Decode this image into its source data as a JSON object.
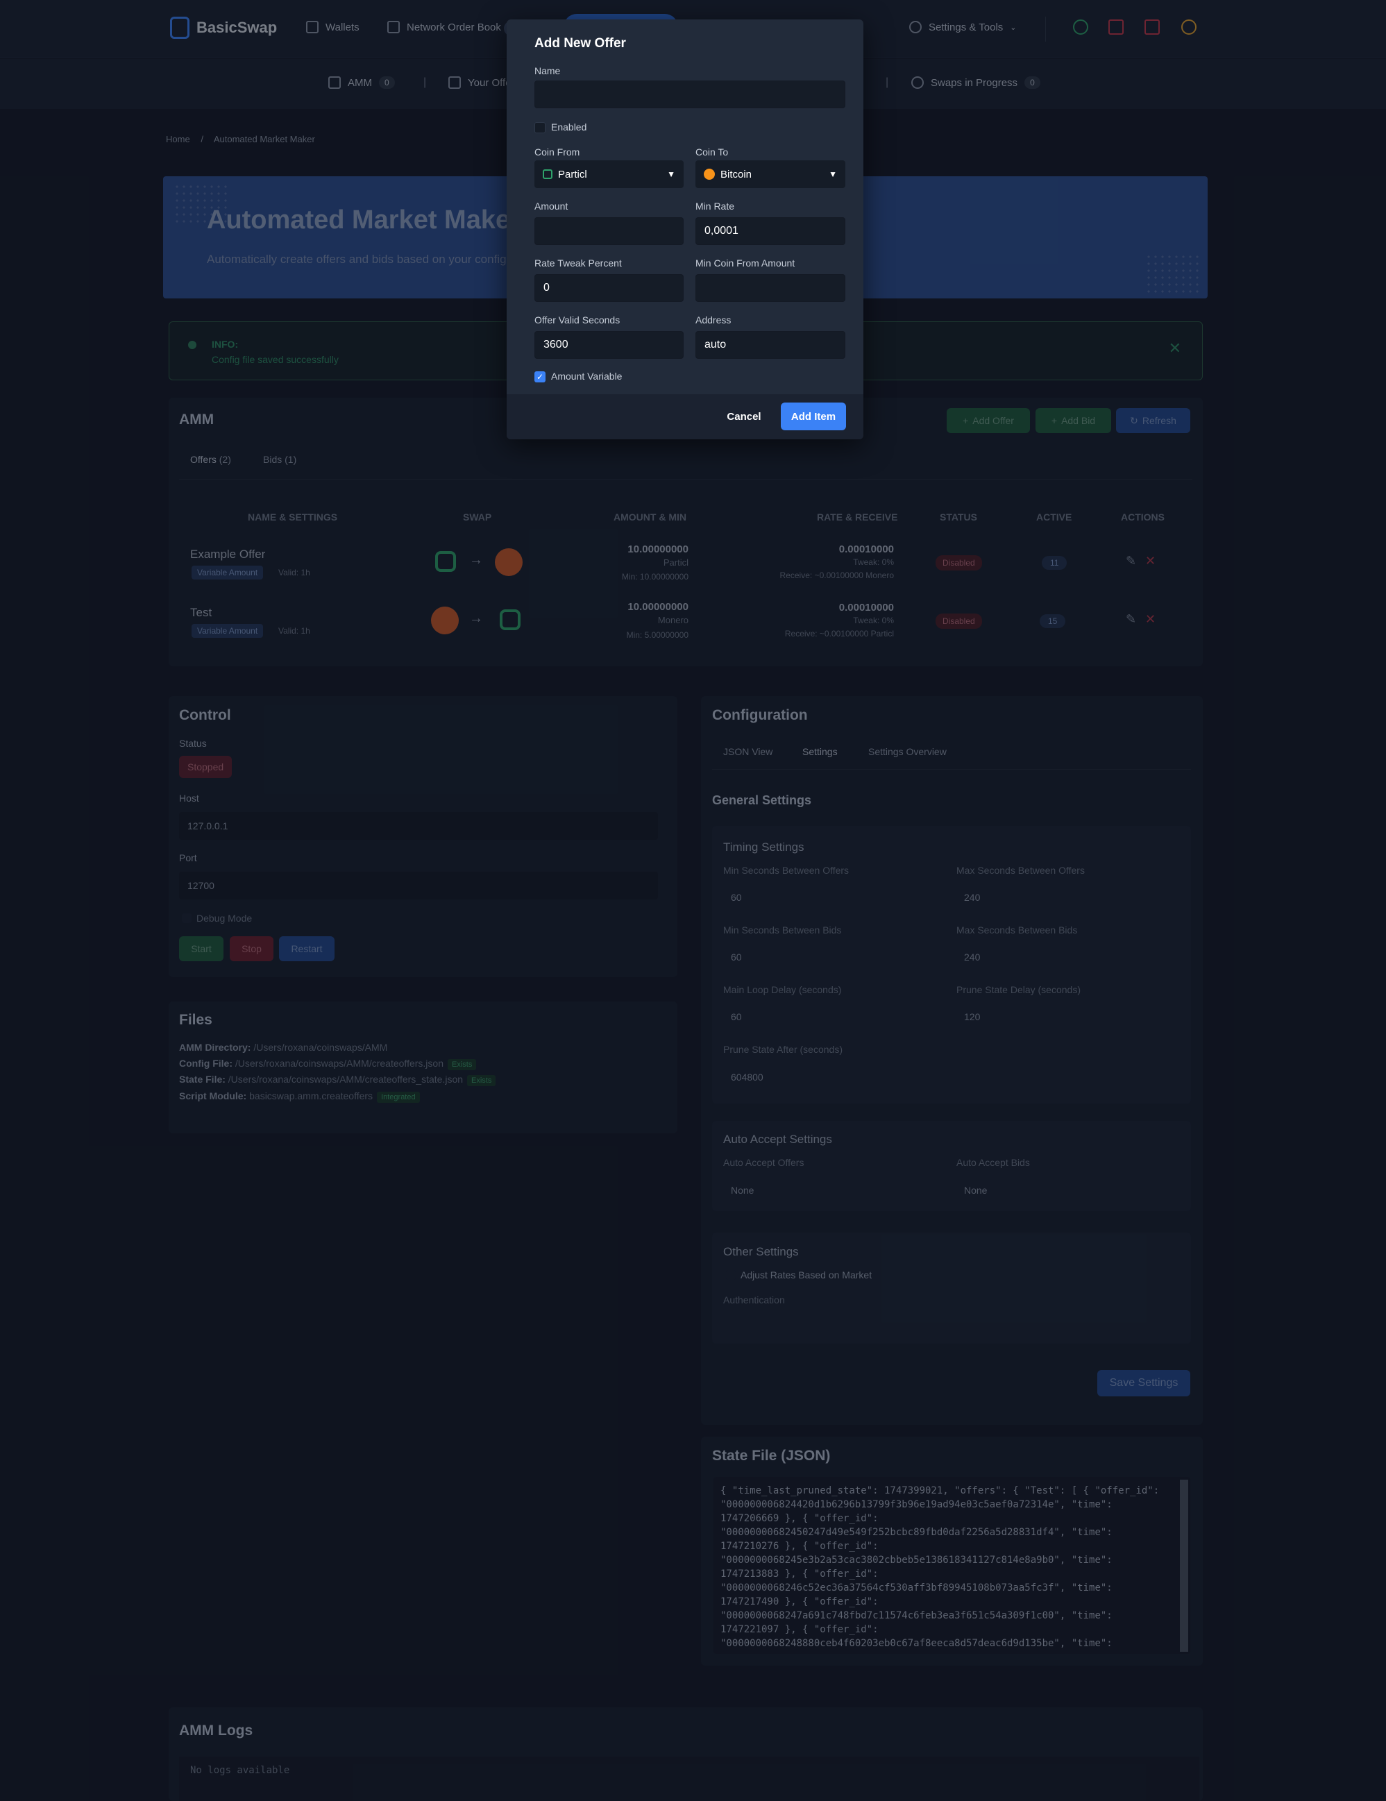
{
  "nav": {
    "logo": "BasicSwap",
    "wallets": "Wallets",
    "order_book": "Network Order Book",
    "settings": "Settings & Tools"
  },
  "subnav": {
    "amm": "AMM",
    "amm_count": "0",
    "your_offers": "Your Offe",
    "swaps": "Swaps in Progress",
    "swaps_count": "0"
  },
  "breadcrumb": {
    "home": "Home",
    "sep": "/",
    "current": "Automated Market Maker"
  },
  "hero": {
    "title": "Automated Market Maker",
    "subtitle": "Automatically create offers and bids based on your configu"
  },
  "info": {
    "title": "INFO:",
    "text": "Config file saved successfully"
  },
  "amm": {
    "title": "AMM",
    "add_offer": "Add Offer",
    "add_bid": "Add Bid",
    "refresh": "Refresh",
    "tabs": {
      "offers": "Offers",
      "offers_count": "(2)",
      "bids": "Bids",
      "bids_count": "(1)"
    },
    "columns": {
      "name": "NAME & SETTINGS",
      "swap": "SWAP",
      "amount": "AMOUNT & MIN",
      "rate": "RATE & RECEIVE",
      "status": "STATUS",
      "active": "ACTIVE",
      "actions": "ACTIONS"
    },
    "rows": [
      {
        "name": "Example Offer",
        "tag": "Variable Amount",
        "valid": "Valid: 1h",
        "amount": "10.00000000",
        "coin": "Particl",
        "min": "Min: 10.00000000",
        "rate": "0.00010000",
        "tweak": "Tweak: 0%",
        "receive": "Receive: ~0.00100000 Monero",
        "status": "Disabled",
        "active": "11"
      },
      {
        "name": "Test",
        "tag": "Variable Amount",
        "valid": "Valid: 1h",
        "amount": "10.00000000",
        "coin": "Monero",
        "min": "Min: 5.00000000",
        "rate": "0.00010000",
        "tweak": "Tweak: 0%",
        "receive": "Receive: ~0.00100000 Particl",
        "status": "Disabled",
        "active": "15"
      }
    ]
  },
  "control": {
    "title": "Control",
    "status_label": "Status",
    "status": "Stopped",
    "host_label": "Host",
    "host": "127.0.0.1",
    "port_label": "Port",
    "port": "12700",
    "debug": "Debug Mode",
    "start": "Start",
    "stop": "Stop",
    "restart": "Restart"
  },
  "files": {
    "title": "Files",
    "dir_label": "AMM Directory:",
    "dir": "/Users/roxana/coinswaps/AMM",
    "config_label": "Config File:",
    "config": "/Users/roxana/coinswaps/AMM/createoffers.json",
    "config_tag": "Exists",
    "state_label": "State File:",
    "state": "/Users/roxana/coinswaps/AMM/createoffers_state.json",
    "state_tag": "Exists",
    "module_label": "Script Module:",
    "module": "basicswap.amm.createoffers",
    "module_tag": "Integrated"
  },
  "config": {
    "title": "Configuration",
    "tabs": {
      "json": "JSON View",
      "settings": "Settings",
      "overview": "Settings Overview"
    },
    "general": "General Settings",
    "timing": "Timing Settings",
    "fields": [
      {
        "label": "Min Seconds Between Offers",
        "value": "60"
      },
      {
        "label": "Max Seconds Between Offers",
        "value": "240"
      },
      {
        "label": "Min Seconds Between Bids",
        "value": "60"
      },
      {
        "label": "Max Seconds Between Bids",
        "value": "240"
      },
      {
        "label": "Main Loop Delay (seconds)",
        "value": "60"
      },
      {
        "label": "Prune State Delay (seconds)",
        "value": "120"
      },
      {
        "label": "Prune State After (seconds)",
        "value": "604800"
      }
    ],
    "auto_accept": "Auto Accept Settings",
    "auto_offers_label": "Auto Accept Offers",
    "auto_offers": "None",
    "auto_bids_label": "Auto Accept Bids",
    "auto_bids": "None",
    "other": "Other Settings",
    "adjust": "Adjust Rates Based on Market",
    "auth": "Authentication",
    "save": "Save Settings"
  },
  "state": {
    "title": "State File (JSON)",
    "lines": [
      "{ \"time_last_pruned_state\": 1747399021, \"offers\": { \"Test\": [ { \"offer_id\":",
      "\"000000006824420d1b6296b13799f3b96e19ad94e03c5aef0a72314e\", \"time\":",
      "1747206669 }, { \"offer_id\":",
      "\"00000000682450247d49e549f252bcbc89fbd0daf2256a5d28831df4\", \"time\":",
      "1747210276 }, { \"offer_id\":",
      "\"0000000068245e3b2a53cac3802cbbeb5e138618341127c814e8a9b0\", \"time\":",
      "1747213883 }, { \"offer_id\":",
      "\"0000000068246c52ec36a37564cf530aff3bf89945108b073aa5fc3f\", \"time\":",
      "1747217490 }, { \"offer_id\":",
      "\"0000000068247a691c748fbd7c11574c6feb3ea3f651c54a309f1c00\", \"time\":",
      "1747221097 }, { \"offer_id\":",
      "\"0000000068248880ceb4f60203eb0c67af8eeca8d57deac6d9d135be\", \"time\":"
    ]
  },
  "logs": {
    "title": "AMM Logs",
    "empty": "No logs available"
  },
  "modal": {
    "title": "Add New Offer",
    "name_label": "Name",
    "name_value": "",
    "enabled": "Enabled",
    "coin_from_label": "Coin From",
    "coin_from": "Particl",
    "coin_to_label": "Coin To",
    "coin_to": "Bitcoin",
    "amount_label": "Amount",
    "amount_value": "",
    "min_rate_label": "Min Rate",
    "min_rate": "0,0001",
    "tweak_label": "Rate Tweak Percent",
    "tweak": "0",
    "min_coin_label": "Min Coin From Amount",
    "min_coin": "",
    "valid_label": "Offer Valid Seconds",
    "valid": "3600",
    "address_label": "Address",
    "address": "auto",
    "amount_variable": "Amount Variable",
    "cancel": "Cancel",
    "add": "Add Item"
  }
}
